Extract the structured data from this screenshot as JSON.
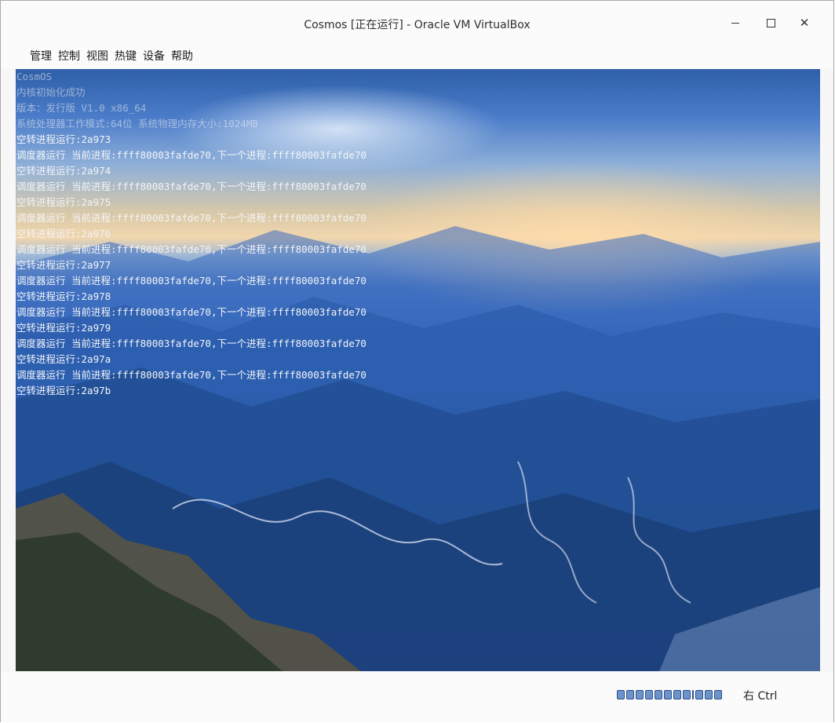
{
  "window": {
    "title": "Cosmos [正在运行] - Oracle VM VirtualBox",
    "controls": {
      "minimize": "—",
      "maximize": "□",
      "close": "✕"
    }
  },
  "menu": [
    "管理",
    "控制",
    "视图",
    "热键",
    "设备",
    "帮助"
  ],
  "console": {
    "lines": [
      {
        "text": "CosmOS",
        "faded": true
      },
      {
        "text": "内核初始化成功",
        "faded": true
      },
      {
        "text": "版本：发行版 V1.0 x86_64",
        "faded": true
      },
      {
        "text": "系统处理器工作模式:64位 系统物理内存大小:1024MB",
        "faded": true
      },
      {
        "text": "空转进程运行:2a973",
        "faded": false
      },
      {
        "text": "调度器运行 当前进程:ffff80003fafde70,下一个进程:ffff80003fafde70",
        "faded": false
      },
      {
        "text": "空转进程运行:2a974",
        "faded": false
      },
      {
        "text": "调度器运行 当前进程:ffff80003fafde70,下一个进程:ffff80003fafde70",
        "faded": false
      },
      {
        "text": "空转进程运行:2a975",
        "faded": false
      },
      {
        "text": "调度器运行 当前进程:ffff80003fafde70,下一个进程:ffff80003fafde70",
        "faded": false
      },
      {
        "text": "空转进程运行:2a976",
        "faded": false
      },
      {
        "text": "调度器运行 当前进程:ffff80003fafde70,下一个进程:ffff80003fafde70",
        "faded": false
      },
      {
        "text": "空转进程运行:2a977",
        "faded": false
      },
      {
        "text": "调度器运行 当前进程:ffff80003fafde70,下一个进程:ffff80003fafde70",
        "faded": false
      },
      {
        "text": "空转进程运行:2a978",
        "faded": false
      },
      {
        "text": "调度器运行 当前进程:ffff80003fafde70,下一个进程:ffff80003fafde70",
        "faded": false
      },
      {
        "text": "空转进程运行:2a979",
        "faded": false
      },
      {
        "text": "调度器运行 当前进程:ffff80003fafde70,下一个进程:ffff80003fafde70",
        "faded": false
      },
      {
        "text": "空转进程运行:2a97a",
        "faded": false
      },
      {
        "text": "调度器运行 当前进程:ffff80003fafde70,下一个进程:ffff80003fafde70",
        "faded": false
      },
      {
        "text": "空转进程运行:2a97b",
        "faded": false
      }
    ]
  },
  "statusbar": {
    "tray_icons": [
      "hard-disk-icon",
      "optical-drive-icon",
      "audio-icon",
      "network-icon",
      "usb-icon",
      "shared-folders-icon",
      "display-icon",
      "recording-icon",
      "separator",
      "cpu-icon",
      "mouse-integration-icon",
      "keyboard-icon"
    ],
    "host_key": "右 Ctrl"
  }
}
